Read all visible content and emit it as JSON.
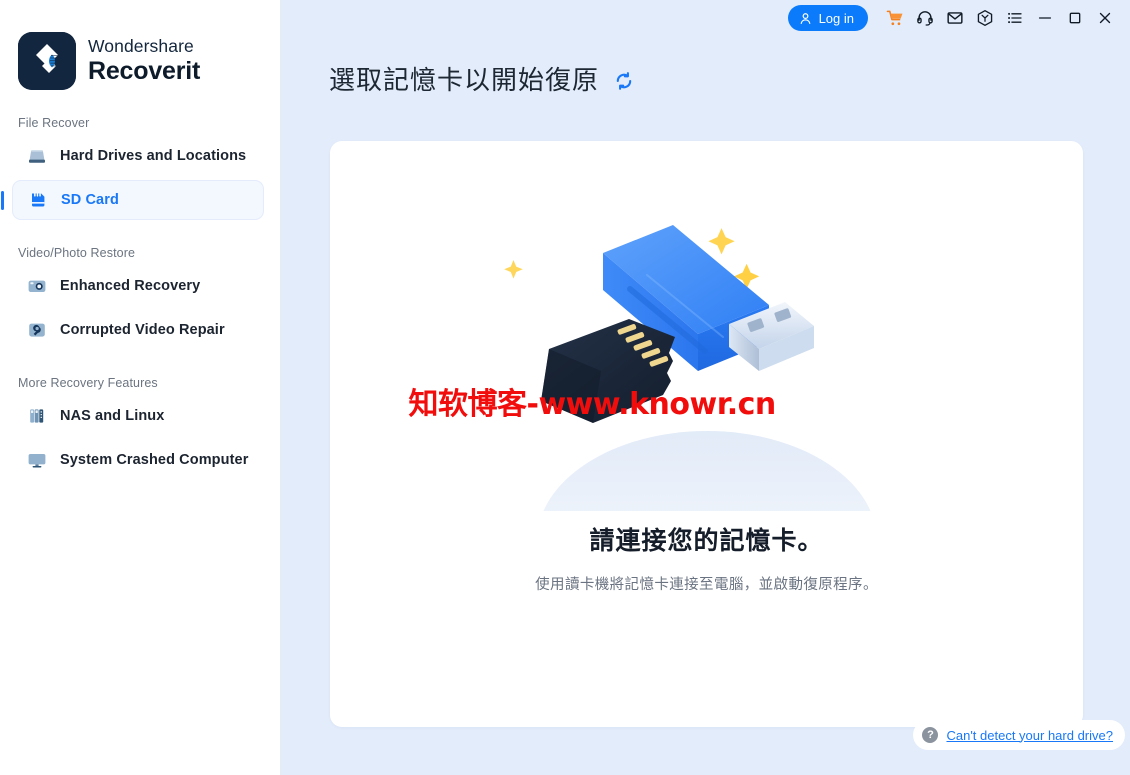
{
  "brand": {
    "top": "Wondershare",
    "bottom": "Recoverit",
    "logo_icon": "recoverit-diamond-logo"
  },
  "sidebar": {
    "groups": [
      {
        "label": "File Recover",
        "items": [
          {
            "label": "Hard Drives and Locations",
            "icon": "hard-drive-icon",
            "active": false
          },
          {
            "label": "SD Card",
            "icon": "sd-card-icon",
            "active": true
          }
        ]
      },
      {
        "label": "Video/Photo Restore",
        "items": [
          {
            "label": "Enhanced Recovery",
            "icon": "camera-icon",
            "active": false
          },
          {
            "label": "Corrupted Video Repair",
            "icon": "video-repair-wrench-icon",
            "active": false
          }
        ]
      },
      {
        "label": "More Recovery Features",
        "items": [
          {
            "label": "NAS and Linux",
            "icon": "nas-server-icon",
            "active": false
          },
          {
            "label": "System Crashed Computer",
            "icon": "monitor-icon",
            "active": false
          }
        ]
      }
    ]
  },
  "titlebar": {
    "login_label": "Log in",
    "login_icon": "user-icon",
    "icons": [
      {
        "name": "cart-icon",
        "title": "Store"
      },
      {
        "name": "headset-icon",
        "title": "Support"
      },
      {
        "name": "envelope-icon",
        "title": "Messages"
      },
      {
        "name": "product-box-icon",
        "title": "Products"
      },
      {
        "name": "list-menu-icon",
        "title": "Menu"
      },
      {
        "name": "minimize-icon",
        "title": "Minimize"
      },
      {
        "name": "maximize-icon",
        "title": "Maximize"
      },
      {
        "name": "close-icon",
        "title": "Close"
      }
    ]
  },
  "page": {
    "title": "選取記憶卡以開始復原",
    "refresh_icon": "refresh-icon"
  },
  "empty_state": {
    "illustration": "usb-drive-and-sd-card-illustration",
    "headline": "請連接您的記憶卡。",
    "subline": "使用讀卡機將記憶卡連接至電腦，並啟動復原程序。",
    "watermark": "知软博客-www.knowr.cn"
  },
  "help": {
    "icon": "question-mark-icon",
    "link_text": "Can't detect your hard drive?"
  },
  "colors": {
    "accent_blue": "#1878f8",
    "login_blue": "#0b7bfb",
    "main_bg": "#e2ecfa",
    "card_bg": "#ffffff",
    "sidebar_bg": "#ffffff",
    "brand_dark": "#12263f",
    "cart_orange": "#f5801e",
    "watermark_red": "#f20d0d",
    "muted_text": "#6b7480"
  }
}
